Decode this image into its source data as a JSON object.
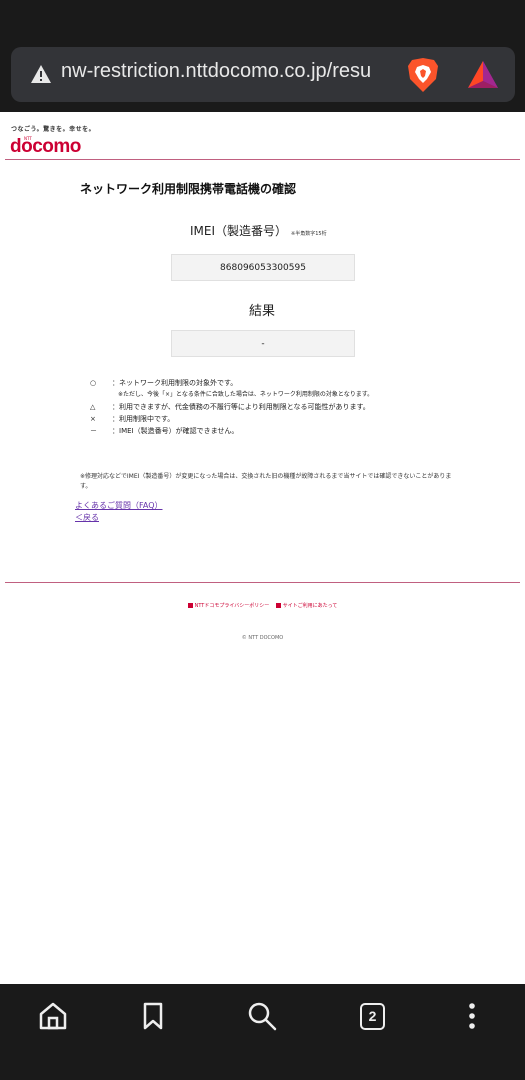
{
  "browser": {
    "url": "nw-restriction.nttdocomo.co.jp/resu",
    "tab_count": "2"
  },
  "header": {
    "tagline": "つなごう。驚きを。幸せを。",
    "logo_small": "NTT",
    "logo": "docomo"
  },
  "main": {
    "title": "ネットワーク利用制限携帯電話機の確認",
    "imei_label": "IMEI（製造番号）",
    "imei_note": "※半角数字15桁",
    "imei_value": "868096053300595",
    "result_label": "結果",
    "result_value": "-"
  },
  "legend": [
    {
      "symbol": "○",
      "text": "：ネットワーク利用制限の対象外です。"
    },
    {
      "symbol": "",
      "text": "※ただし、今後「×」となる条件に合致した場合は、ネットワーク利用制限の対象となります。"
    },
    {
      "symbol": "△",
      "text": "：利用できますが、代金債務の不履行等により利用制限となる可能性があります。"
    },
    {
      "symbol": "×",
      "text": "：利用制限中です。"
    },
    {
      "symbol": "－",
      "text": "：IMEI（製造番号）が確認できません。"
    }
  ],
  "footnote": "※修理対応などでIMEI（製造番号）が変更になった場合は、交換された旧の機種が故障されるまで当サイトでは確認できないことがあります。",
  "links": {
    "faq": "よくあるご質問（FAQ）",
    "back": "＜戻る"
  },
  "footer": {
    "privacy": "NTTドコモプライバシーポリシー",
    "site": "サイトご利用にあたって",
    "copyright": "© NTT DOCOMO"
  },
  "colors": {
    "brand": "#cc0033",
    "link": "#6633aa"
  }
}
